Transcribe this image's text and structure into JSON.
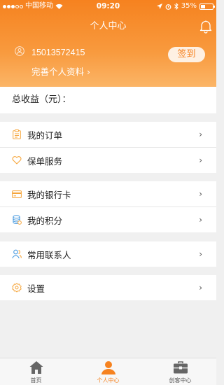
{
  "status_bar": {
    "carrier": "中国移动",
    "time": "09:20",
    "battery": "35%"
  },
  "header": {
    "title": "个人中心",
    "phone": "15013572415",
    "profile_link": "完善个人资料 ›",
    "signin_label": "签到"
  },
  "earnings": {
    "label": "总收益（元）："
  },
  "menu": {
    "orders": "我的订单",
    "warranty": "保单服务",
    "bank_card": "我的银行卡",
    "points": "我的积分",
    "contacts": "常用联系人",
    "settings": "设置"
  },
  "tabs": [
    {
      "label": "首页",
      "icon": "home-icon"
    },
    {
      "label": "个人中心",
      "icon": "person-icon"
    },
    {
      "label": "创客中心",
      "icon": "briefcase-icon"
    }
  ],
  "colors": {
    "accent": "#f6821f",
    "background": "#f0f0f0"
  }
}
